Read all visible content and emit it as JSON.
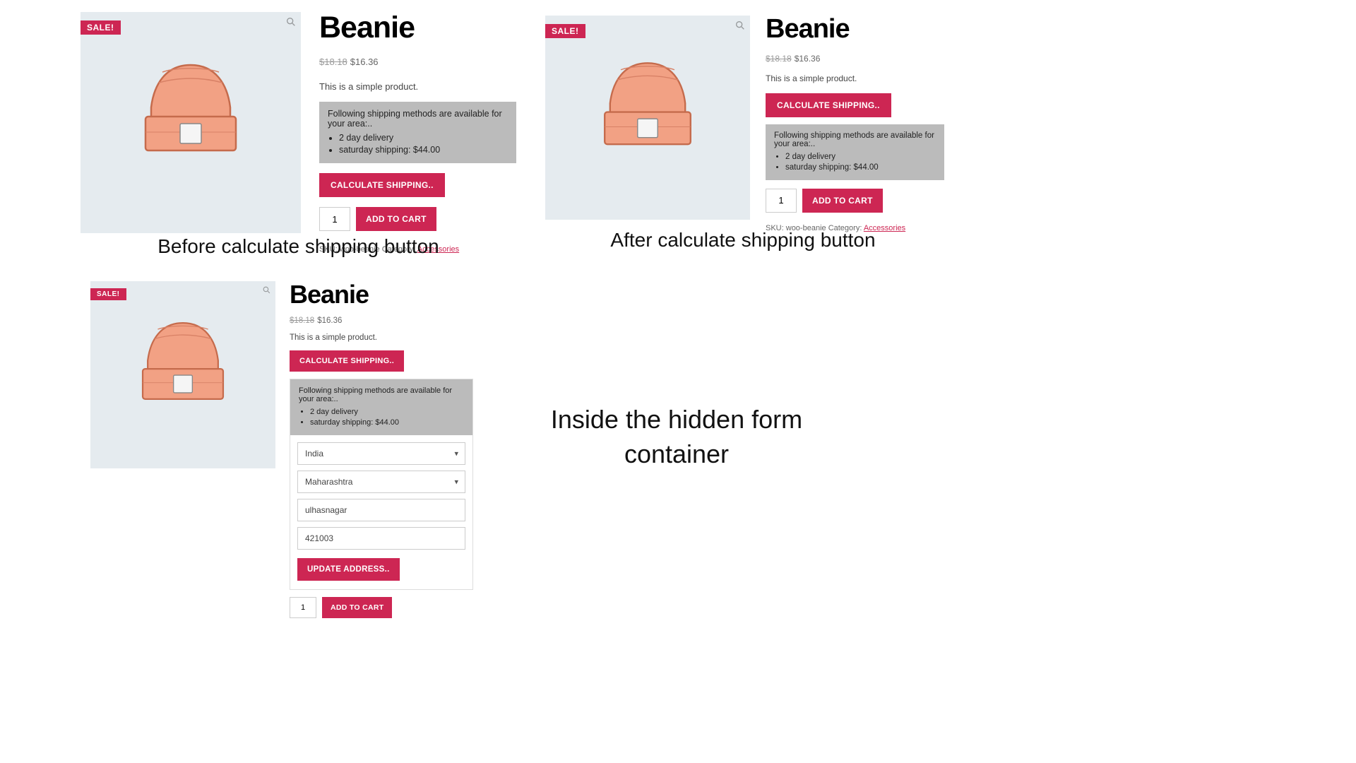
{
  "common": {
    "sale_badge": "SALE!",
    "title": "Beanie",
    "old_price": "$18.18",
    "price": "$16.36",
    "desc": "This is a simple product.",
    "methods_heading": "Following shipping methods are available for your area:..",
    "method1": "2 day delivery",
    "method2": "saturday shipping: $44.00",
    "calc_button": "CALCULATE SHIPPING..",
    "add_button": "ADD TO CART",
    "qty": "1",
    "sku_label": "SKU:",
    "sku_value": "woo-beanie",
    "cat_label": "Category:",
    "cat_value": "Accessories"
  },
  "panel3_form": {
    "country": "India",
    "state": "Maharashtra",
    "city": "ulhasnagar",
    "zip": "421003",
    "update_button": "UPDATE ADDRESS.."
  },
  "captions": {
    "c1": "Before calculate shipping button",
    "c2": "After calculate shipping button",
    "c3": "Inside the hidden form container"
  }
}
